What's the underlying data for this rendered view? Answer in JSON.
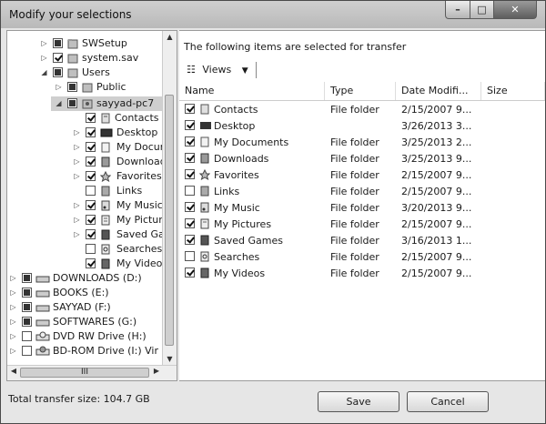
{
  "window": {
    "title": "Modify your selections"
  },
  "tree": {
    "items": [
      {
        "label": "SWSetup",
        "icon": "folder-icon"
      },
      {
        "label": "system.sav",
        "icon": "folder-icon"
      },
      {
        "label": "Users",
        "icon": "folder-icon"
      },
      {
        "label": "Public",
        "icon": "folder-icon"
      },
      {
        "label": "sayyad-pc7",
        "icon": "user-folder-icon"
      },
      {
        "label": "Contacts",
        "icon": "contacts-icon"
      },
      {
        "label": "Desktop",
        "icon": "desktop-icon"
      },
      {
        "label": "My Documents",
        "icon": "documents-icon"
      },
      {
        "label": "Downloads",
        "icon": "downloads-icon"
      },
      {
        "label": "Favorites",
        "icon": "favorites-icon"
      },
      {
        "label": "Links",
        "icon": "links-icon"
      },
      {
        "label": "My Music",
        "icon": "music-icon"
      },
      {
        "label": "My Pictures",
        "icon": "pictures-icon"
      },
      {
        "label": "Saved Games",
        "icon": "games-icon"
      },
      {
        "label": "Searches",
        "icon": "searches-icon"
      },
      {
        "label": "My Videos",
        "icon": "videos-icon"
      },
      {
        "label": "DOWNLOADS (D:)",
        "icon": "drive-icon"
      },
      {
        "label": "BOOKS (E:)",
        "icon": "drive-icon"
      },
      {
        "label": "SAYYAD (F:)",
        "icon": "drive-icon"
      },
      {
        "label": "SOFTWARES (G:)",
        "icon": "drive-icon"
      },
      {
        "label": "DVD RW Drive (H:)",
        "icon": "dvd-drive-icon"
      },
      {
        "label": "BD-ROM Drive (I:) Vir",
        "icon": "bd-drive-icon"
      }
    ],
    "hscroll_grip": "III"
  },
  "right": {
    "header": "The following items are selected for transfer",
    "views_label": "Views",
    "columns": [
      "Name",
      "Type",
      "Date Modifi...",
      "Size"
    ],
    "rows": [
      {
        "name": "Contacts",
        "type": "File folder",
        "date": "2/15/2007 9..."
      },
      {
        "name": "Desktop",
        "type": "",
        "date": "3/26/2013 3..."
      },
      {
        "name": "My Documents",
        "type": "File folder",
        "date": "3/25/2013 2..."
      },
      {
        "name": "Downloads",
        "type": "File folder",
        "date": "3/25/2013 9..."
      },
      {
        "name": "Favorites",
        "type": "File folder",
        "date": "2/15/2007 9..."
      },
      {
        "name": "Links",
        "type": "File folder",
        "date": "2/15/2007 9..."
      },
      {
        "name": "My Music",
        "type": "File folder",
        "date": "3/20/2013 9..."
      },
      {
        "name": "My Pictures",
        "type": "File folder",
        "date": "2/15/2007 9..."
      },
      {
        "name": "Saved Games",
        "type": "File folder",
        "date": "3/16/2013 1..."
      },
      {
        "name": "Searches",
        "type": "File folder",
        "date": "2/15/2007 9..."
      },
      {
        "name": "My Videos",
        "type": "File folder",
        "date": "2/15/2007 9..."
      }
    ]
  },
  "footer": {
    "total": "Total transfer size: 104.7 GB",
    "save": "Save",
    "cancel": "Cancel"
  }
}
